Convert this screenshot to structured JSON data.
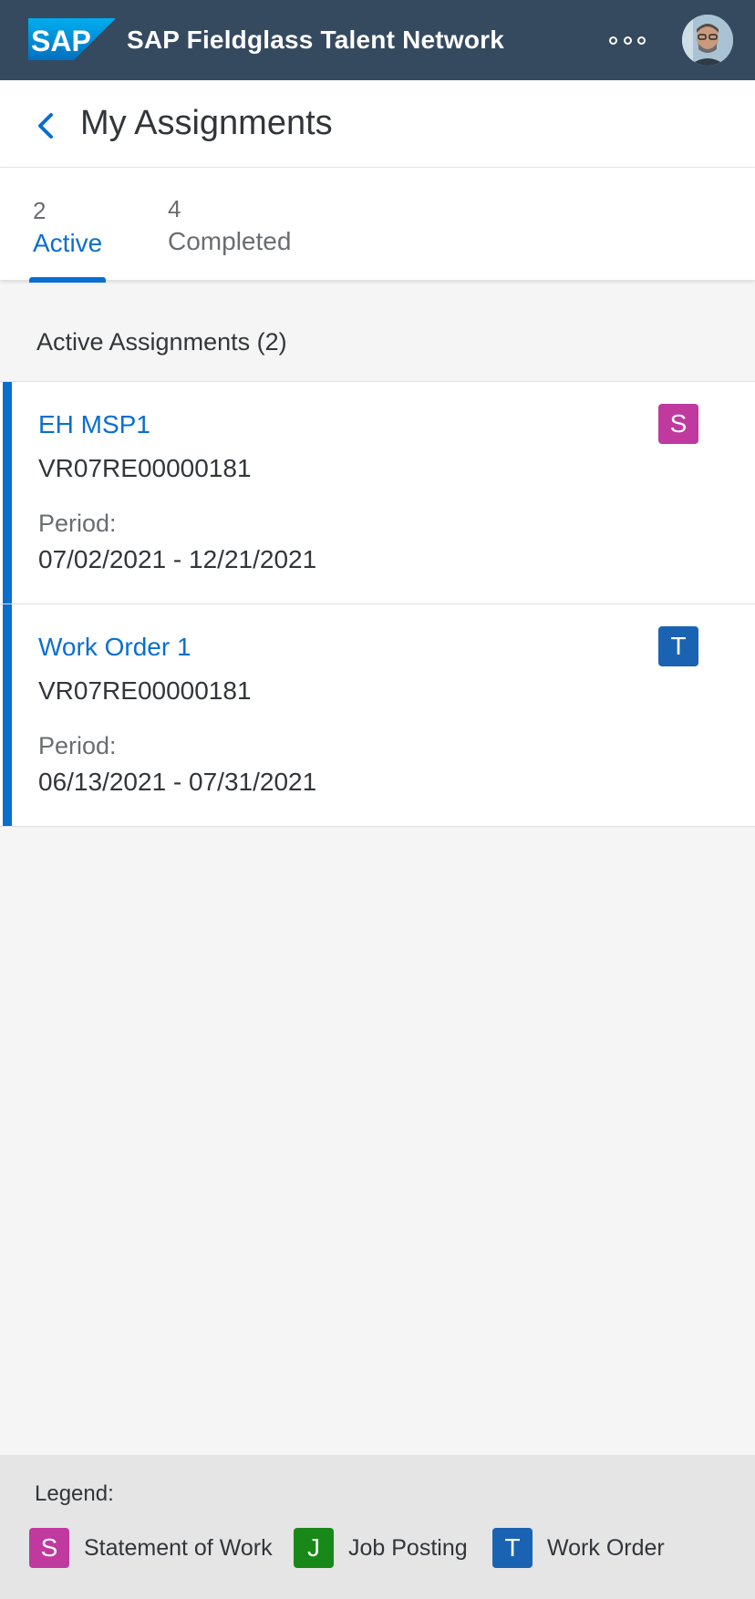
{
  "shell": {
    "logo_text": "SAP",
    "title": "SAP Fieldglass Talent Network",
    "overflow_icon": "overflow-icon",
    "avatar_icon": "user-avatar",
    "background": "#354a5f"
  },
  "header": {
    "back_icon": "chevron-left-icon",
    "title": "My Assignments"
  },
  "tabs": [
    {
      "count": "2",
      "label": "Active",
      "selected": true
    },
    {
      "count": "4",
      "label": "Completed",
      "selected": false
    }
  ],
  "section": {
    "title": "Active Assignments (2)"
  },
  "assignments": [
    {
      "title": "EH MSP1",
      "id": "VR07RE00000181",
      "period_label": "Period:",
      "period": "07/02/2021 - 12/21/2021",
      "type_letter": "S",
      "type_color": "#c0399f"
    },
    {
      "title": "Work Order 1",
      "id": "VR07RE00000181",
      "period_label": "Period:",
      "period": "06/13/2021 - 07/31/2021",
      "type_letter": "T",
      "type_color": "#1a63b3"
    }
  ],
  "legend": {
    "title": "Legend:",
    "items": [
      {
        "letter": "S",
        "label": "Statement of Work",
        "color": "#c0399f"
      },
      {
        "letter": "J",
        "label": "Job Posting",
        "color": "#188918"
      },
      {
        "letter": "T",
        "label": "Work Order",
        "color": "#1a63b3"
      }
    ]
  },
  "colors": {
    "accent": "#0a6ed1",
    "text": "#32363a",
    "muted": "#6a6d70"
  }
}
